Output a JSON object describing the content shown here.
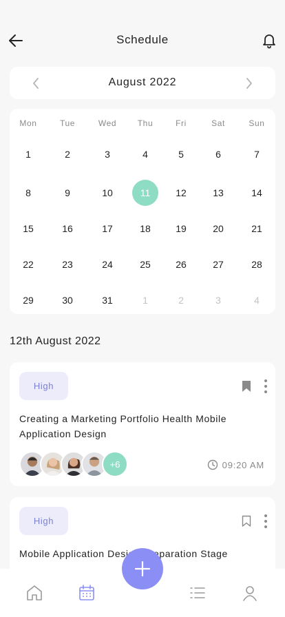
{
  "header": {
    "title": "Schedule"
  },
  "calendar": {
    "month_label": "August 2022",
    "weekdays": [
      "Mon",
      "Tue",
      "Wed",
      "Thu",
      "Fri",
      "Sat",
      "Sun"
    ],
    "weeks": [
      [
        "1",
        "2",
        "3",
        "4",
        "5",
        "6",
        "7"
      ],
      [
        "8",
        "9",
        "10",
        "11",
        "12",
        "13",
        "14"
      ],
      [
        "15",
        "16",
        "17",
        "18",
        "19",
        "20",
        "21"
      ],
      [
        "22",
        "23",
        "24",
        "25",
        "26",
        "27",
        "28"
      ],
      [
        "29",
        "30",
        "31",
        "1",
        "2",
        "3",
        "4"
      ]
    ],
    "selected_day": "11"
  },
  "schedule": {
    "date_heading": "12th August 2022",
    "tasks": [
      {
        "priority": "High",
        "title": "Creating a Marketing Portfolio Health Mobile Application Design",
        "extra_members": "+6",
        "time": "09:20 AM",
        "bookmarked": true
      },
      {
        "priority": "High",
        "title": "Mobile Application Design Preparation Stage",
        "bookmarked": false
      }
    ]
  },
  "colors": {
    "accent": "#8b8ff5",
    "selected_day": "#8fdcc4",
    "badge_bg": "#ececfb",
    "badge_text": "#7d80d8"
  },
  "icons": {
    "back": "arrow-left-icon",
    "notifications": "bell-icon",
    "add": "plus-icon",
    "time": "clock-icon"
  }
}
